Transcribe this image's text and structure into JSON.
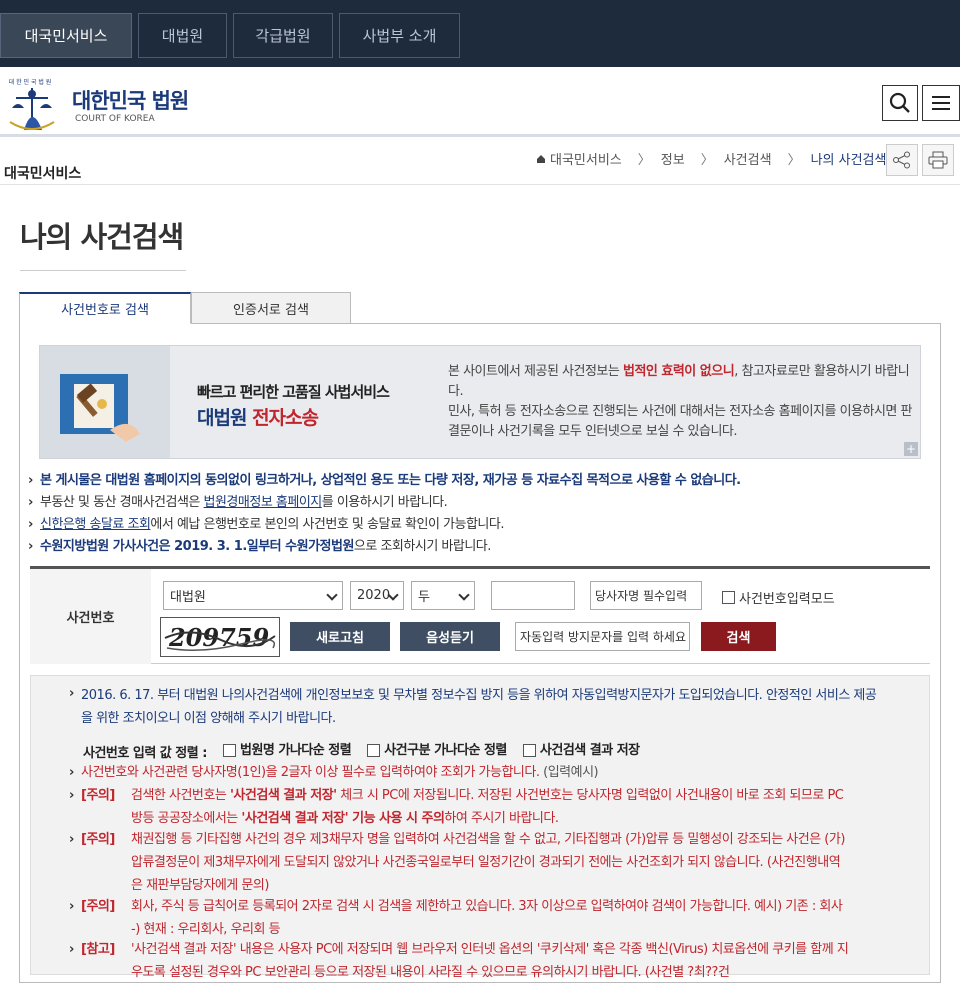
{
  "topnav": {
    "tabs": [
      {
        "label": "대국민서비스"
      },
      {
        "label": "대법원"
      },
      {
        "label": "각급법원"
      },
      {
        "label": "사법부 소개"
      }
    ]
  },
  "header": {
    "brand": "대한민국 법원",
    "brand_sub": "COURT OF KOREA",
    "logo_text": "대한민국법원"
  },
  "subbar": {
    "section": "대국민서비스",
    "breadcrumb": [
      "대국민서비스",
      "정보",
      "사건검색",
      "나의 사건검색"
    ]
  },
  "page": {
    "title": "나의 사건검색",
    "tabs": [
      {
        "label": "사건번호로 검색"
      },
      {
        "label": "인증서로 검색"
      }
    ]
  },
  "banner": {
    "headline1": "빠르고 편리한 고품질 사법서비스",
    "headline2_a": "대법원 ",
    "headline2_b": "전자소송",
    "text1_a": "본 사이트에서 제공된 사건정보는 ",
    "text1_b": "법적인 효력이 없으니",
    "text1_c": ", 참고자료로만 활용하시기 바랍니다.",
    "text2": "민사, 특허 등 전자소송으로 진행되는 사건에 대해서는 전자소송 홈페이지를 이용하시면 판결문이나 사건기록을 모두 인터넷으로 보실 수 있습니다."
  },
  "notes": {
    "n1": "본 게시물은 대법원 홈페이지의 동의없이 링크하거나, 상업적인 용도 또는 다량 저장, 재가공 등 자료수집 목적으로 사용할 수 없습니다.",
    "n2_a": "부동산 및 동산 경매사건검색은 ",
    "n2_link": "법원경매정보 홈페이지",
    "n2_b": "를 이용하시기 바랍니다.",
    "n3_link": "신한은행 송달료 조회",
    "n3_b": "에서 예납 은행번호로 본인의 사건번호 및 송달료 확인이 가능합니다.",
    "n4_a": "수원지방법원 가사사건은 2019. 3. 1.일부터 수원가정법원",
    "n4_b": "으로 조회하시기 바랍니다."
  },
  "form": {
    "label": "사건번호",
    "court": "대법원",
    "year": "2020",
    "type": "두",
    "number": "",
    "party_placeholder": "당사자명 필수입력",
    "mode_label": "사건번호입력모드",
    "captcha_text": "209759",
    "refresh_label": "새로고침",
    "audio_label": "음성듣기",
    "captcha_placeholder": "자동입력 방지문자를 입력 하세요",
    "search_label": "검색"
  },
  "info": {
    "intro": "2016. 6. 17. 부터 대법원 나의사건검색에 개인정보보호 및 무차별 정보수집 방지 등을 위하여 자동입력방지문자가 도입되었습니다. 안정적인 서비스 제공을 위한 조치이오니 이점 양해해 주시기 바랍니다.",
    "sort_label": "사건번호 입력 값 정렬 :",
    "opt1": "법원명 가나다순 정렬",
    "opt2": "사건구분 가나다순 정렬",
    "opt3": "사건검색 결과 저장",
    "line1_a": "사건번호와 사건관련 당사자명(1인)을 2글자 이상 필수로 입력하여야 조회가 가능합니다.",
    "line1_b": "(입력예시)",
    "c1_tag": "[주의]",
    "c1_a": "검색한 사건번호는 ",
    "c1_b": "'사건검색 결과 저장'",
    "c1_c": " 체크 시 PC에 저장됩니다. 저장된 사건번호는 당사자명 입력없이 사건내용이 바로 조회 되므로 PC방등 공공장소에서는 ",
    "c1_d": "'사건검색 결과 저장' 기능 사용 시 주의",
    "c1_e": "하여 주시기 바랍니다.",
    "c2_tag": "[주의]",
    "c2": "채권집행 등 기타집행 사건의 경우 제3채무자 명을 입력하여 사건검색을 할 수 없고, 기타집행과 (가)압류 등 밀행성이 강조되는 사건은 (가)압류결정문이 제3채무자에게 도달되지 않았거나 사건종국일로부터 일정기간이 경과되기 전에는 사건조회가 되지 않습니다. (사건진행내역은 재판부담당자에게 문의)",
    "c3_tag": "[주의]",
    "c3": "회사, 주식 등 급칙어로 등록되어 2자로 검색 시 검색을 제한하고 있습니다. 3자 이상으로 입력하여야 검색이 가능합니다. 예시) 기존 : 회사 -) 현재 : 우리회사, 우리회 등",
    "c4_tag": "[참고]",
    "c4": "'사건검색 결과 저장' 내용은 사용자 PC에 저장되며 웹 브라우저 인터넷 옵션의 '쿠키삭제' 혹은 각종 백신(Virus) 치료옵션에 쿠키를 함께 지우도록 설정된 경우와 PC 보안관리 등으로 저장된 내용이 사라질 수 있으므로 유의하시기 바랍니다. (사건별 ?최??건"
  },
  "colors": {
    "navy": "#1e2b3c",
    "brand": "#1b3a7a",
    "alert": "#c0262d",
    "search_btn": "#8b1a1e",
    "dark_btn": "#3f4e63"
  }
}
